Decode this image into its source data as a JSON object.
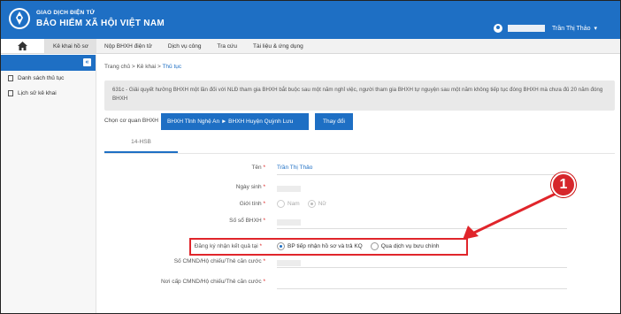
{
  "header": {
    "org_line1": "GIAO DỊCH ĐIỆN TỬ",
    "org_line2": "BẢO HIỂM XÃ HỘI VIỆT NAM",
    "user_name": "Trần Thị Thảo"
  },
  "nav": {
    "items": [
      "Kê khai hồ sơ",
      "Nộp BHXH điện tử",
      "Dịch vụ công",
      "Tra cứu",
      "Tài liệu & ứng dụng"
    ]
  },
  "sidebar": {
    "items": [
      "Danh sách thủ tục",
      "Lịch sử kê khai"
    ]
  },
  "breadcrumb": {
    "home": "Trang chủ",
    "sep": ">",
    "section": "Kê khai",
    "current": "Thủ tục"
  },
  "description": "631c - Giải quyết hưởng BHXH một lần đối với NLĐ tham gia BHXH bắt buộc sau một năm nghỉ việc, người tham gia BHXH tự nguyện sau một năm không tiếp tục đóng BHXH mà chưa đủ 20 năm đóng BHXH",
  "agency": {
    "label": "Chọn cơ quan BHXH",
    "value": "BHXH Tỉnh Nghệ An ► BHXH Huyện Quỳnh Lưu",
    "change_button": "Thay đổi"
  },
  "tab": {
    "label": "14-HSB"
  },
  "form": {
    "name_label": "Tên",
    "name_value": "Trần Thị Thảo",
    "dob_label": "Ngày sinh",
    "gender_label": "Giới tính",
    "gender_options": [
      "Nam",
      "Nữ"
    ],
    "gender_selected": "Nữ",
    "bhxh_label": "Số sổ BHXH",
    "receive_label": "Đăng ký nhận kết quả tại",
    "receive_options": [
      "BP tiếp nhận hồ sơ và trả KQ",
      "Qua dịch vụ bưu chính"
    ],
    "receive_selected": "BP tiếp nhận hồ sơ và trả KQ",
    "id_label": "Số CMND/Hộ chiếu/Thẻ căn cước",
    "issue_label": "Nơi cấp CMND/Hộ chiếu/Thẻ căn cước",
    "required_mark": "*"
  },
  "annotation": {
    "badge_number": "1",
    "color": "#e0252b"
  },
  "colors": {
    "primary": "#1e6fc4",
    "required": "#dd2222"
  }
}
